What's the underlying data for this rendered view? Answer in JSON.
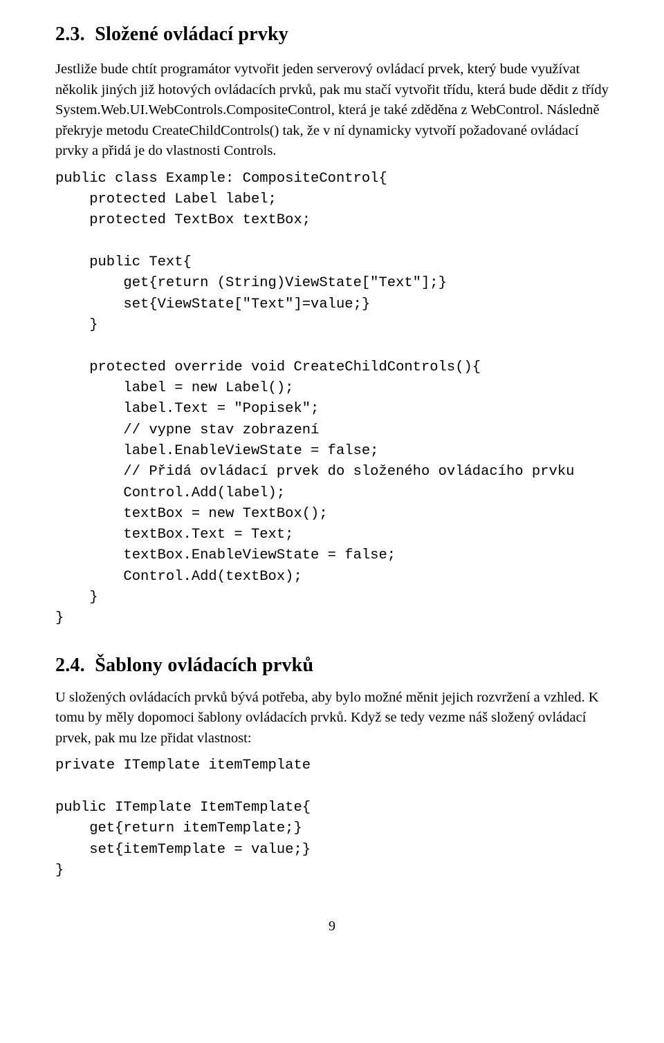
{
  "sec23": {
    "number": "2.3.",
    "title": "Složené ovládací prvky",
    "para1": "Jestliže bude chtít programátor vytvořit jeden serverový ovládací prvek, který bude využívat několik jiných již hotových ovládacích prvků, pak mu stačí vytvořit třídu, která bude dědit z třídy System.Web.UI.WebControls.CompositeControl, která je také zděděna z WebControl. Následně překryje metodu CreateChildControls() tak, že v ní dynamicky vytvoří požadované ovládací prvky a přidá je do vlastnosti Controls."
  },
  "code1": {
    "l01": "public class Example: CompositeControl{",
    "l02": "    protected Label label;",
    "l03": "    protected TextBox textBox;",
    "l04": "    public Text{",
    "l05": "        get{return (String)ViewState[\"Text\"];}",
    "l06": "        set{ViewState[\"Text\"]=value;}",
    "l07": "    }",
    "l08": "    protected override void CreateChildControls(){",
    "l09": "        label = new Label();",
    "l10": "        label.Text = \"Popisek\";",
    "l11": "        // vypne stav zobrazení",
    "l12": "        label.EnableViewState = false;",
    "l13": "        // Přidá ovládací prvek do složeného ovládacího prvku",
    "l14": "        Control.Add(label);",
    "l15": "        textBox = new TextBox();",
    "l16": "        textBox.Text = Text;",
    "l17": "        textBox.EnableViewState = false;",
    "l18": "        Control.Add(textBox);",
    "l19": "    }",
    "l20": "}"
  },
  "sec24": {
    "number": "2.4.",
    "title": "Šablony ovládacích prvků",
    "para1": "U složených ovládacích prvků bývá potřeba, aby bylo možné měnit jejich rozvržení a vzhled. K tomu by měly dopomoci šablony ovládacích prvků. Když se tedy vezme náš složený ovládací prvek, pak mu lze přidat vlastnost:"
  },
  "code2": {
    "l01": "private ITemplate itemTemplate",
    "l02": "public ITemplate ItemTemplate{",
    "l03": "    get{return itemTemplate;}",
    "l04": "    set{itemTemplate = value;}",
    "l05": "}"
  },
  "pagenum": "9"
}
